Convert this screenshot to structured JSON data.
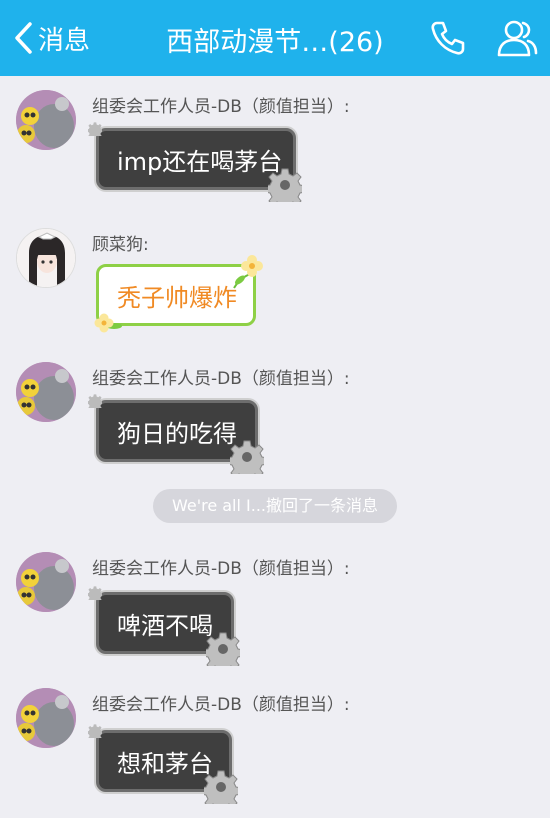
{
  "nav": {
    "back_label": "消息",
    "title": "西部动漫节…(26)",
    "back_icon": "chevron-left-icon",
    "phone_icon": "phone-icon",
    "members_icon": "group-members-icon",
    "bar_color": "#1fb2ec"
  },
  "messages": [
    {
      "sender": "组委会工作人员-DB（颜值担当）:",
      "text": "imp还在喝茅台"
    },
    {
      "sender": "顾菜狗:",
      "text": "秃子帅爆炸"
    },
    {
      "sender": "组委会工作人员-DB（颜值担当）:",
      "text": "狗日的吃得"
    },
    {
      "sender": "组委会工作人员-DB（颜值担当）:",
      "text": "啤酒不喝"
    },
    {
      "sender": "组委会工作人员-DB（颜值担当）:",
      "text": "想和茅台"
    }
  ],
  "recall_notice": "We're all I...撤回了一条消息",
  "colors": {
    "background": "#eeeef3",
    "dark_bubble": "#3f3f3f",
    "green_border": "#8ed046",
    "orange_text": "#f08a24"
  }
}
